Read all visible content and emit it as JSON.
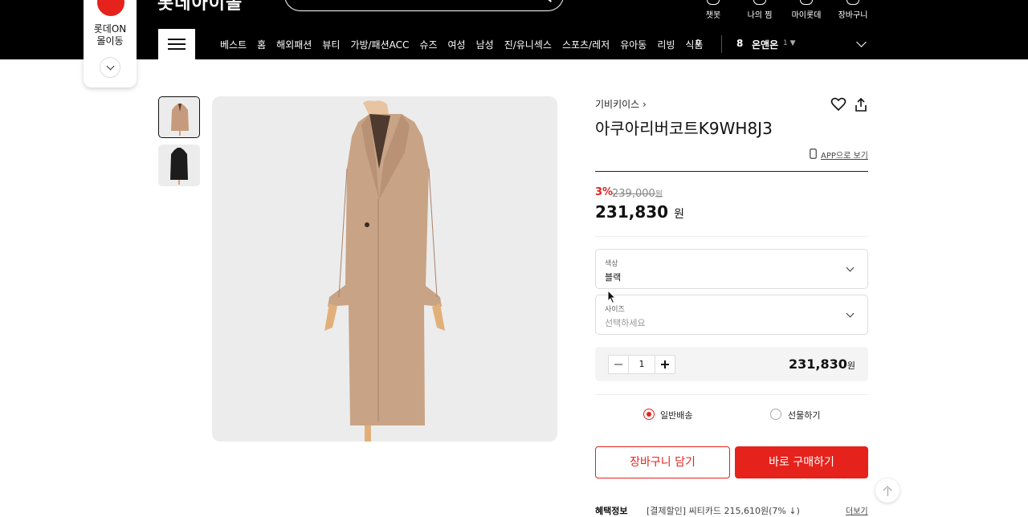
{
  "header": {
    "logo": "롯데아이몰",
    "utilities": [
      {
        "label": "챗봇",
        "icon": "chat-icon"
      },
      {
        "label": "나의 찜",
        "icon": "heart-icon"
      },
      {
        "label": "마이롯데",
        "icon": "user-icon"
      },
      {
        "label": "장바구니",
        "icon": "cart-icon"
      }
    ]
  },
  "mascot": {
    "line1": "롯데ON",
    "line2": "몰이동"
  },
  "nav": {
    "items": [
      "베스트",
      "홈",
      "해외패션",
      "뷰티",
      "가방/패션ACC",
      "슈즈",
      "여성",
      "남성",
      "진/유니섹스",
      "스포츠/레저",
      "유아동",
      "리빙",
      "식품"
    ],
    "extra_count": "0",
    "ranking": {
      "rank": "8",
      "keyword": "온앤온",
      "change": "1 ▼"
    }
  },
  "product": {
    "brand": "기비키이스",
    "title": "아쿠아리버코트K9WH8J3",
    "app_link": "APP으로 보기",
    "discount_rate": "3%",
    "original_price": "239,000",
    "original_unit": "원",
    "price": "231,830",
    "price_unit": "원"
  },
  "options": {
    "color_label": "색상",
    "color_value": "블랙",
    "size_label": "사이즈",
    "size_placeholder": "선택하세요"
  },
  "quantity": {
    "value": "1",
    "total": "231,830",
    "unit": "원"
  },
  "delivery": {
    "normal": "일반배송",
    "gift": "선물하기",
    "selected": "normal"
  },
  "actions": {
    "cart": "장바구니 담기",
    "buy": "바로 구매하기"
  },
  "benefits": {
    "label": "혜택정보",
    "text": "[결제할인] 씨티카드 215,610원(7% ↓)",
    "more": "더보기"
  },
  "colors": {
    "accent": "#e5231c",
    "header_bg": "#000000",
    "image_bg": "#ececec"
  }
}
